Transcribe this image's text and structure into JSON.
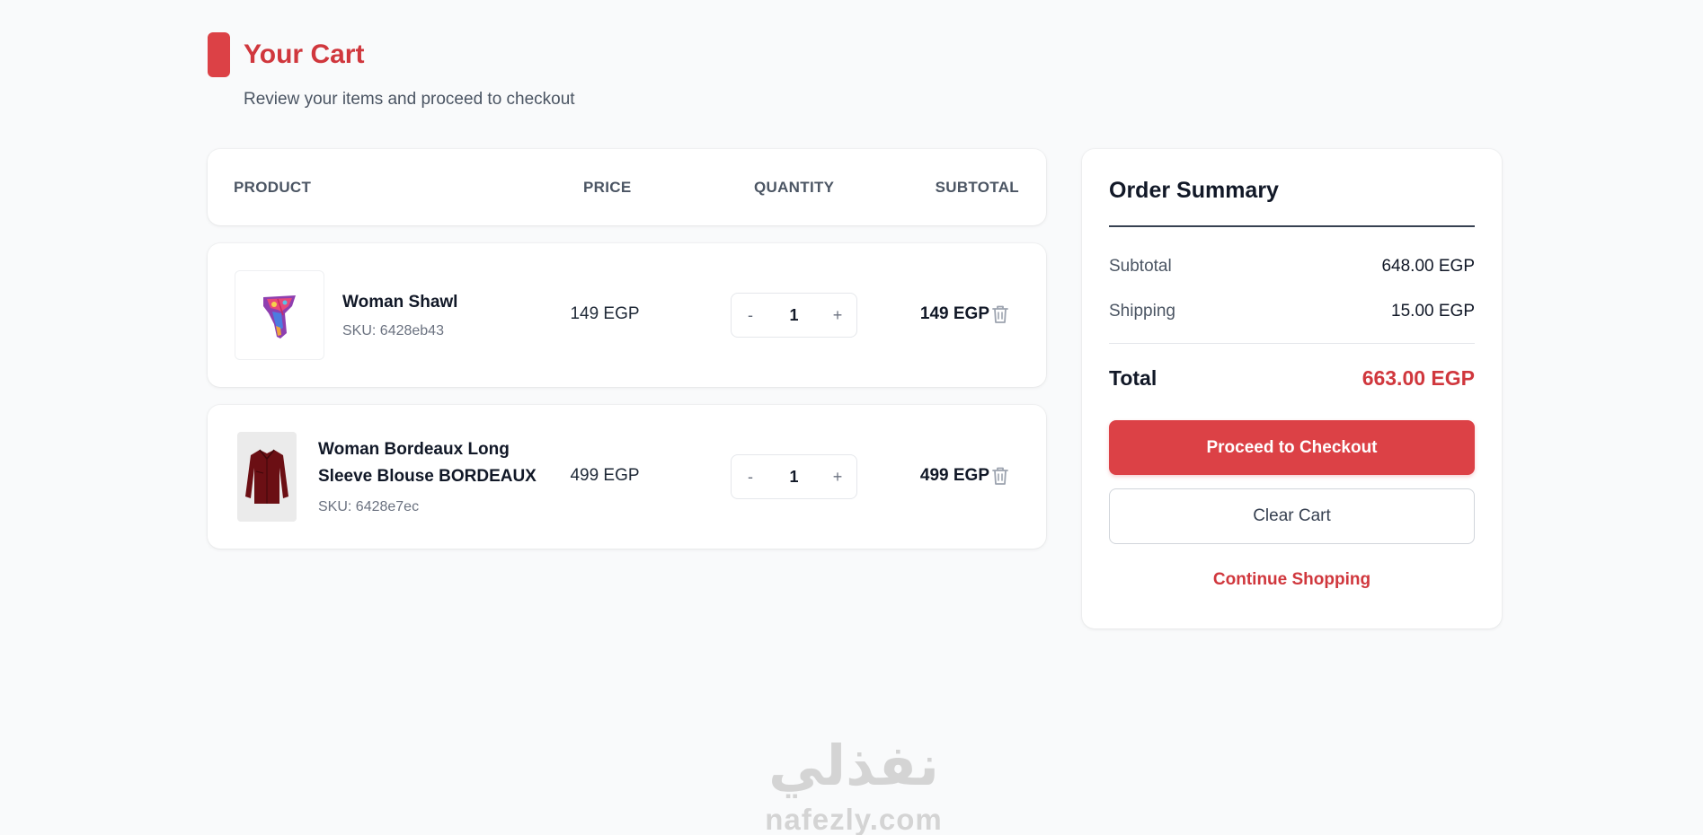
{
  "header": {
    "title": "Your Cart",
    "subtitle": "Review your items and proceed to checkout"
  },
  "table": {
    "columns": [
      "PRODUCT",
      "PRICE",
      "QUANTITY",
      "SUBTOTAL"
    ]
  },
  "cart_items": [
    {
      "name": "Woman Shawl",
      "sku": "SKU: 6428eb43",
      "price": "149 EGP",
      "quantity": "1",
      "subtotal": "149 EGP",
      "decrement_label": "-",
      "increment_label": "+"
    },
    {
      "name": "Woman Bordeaux Long Sleeve Blouse BORDEAUX",
      "sku": "SKU: 6428e7ec",
      "price": "499 EGP",
      "quantity": "1",
      "subtotal": "499 EGP",
      "decrement_label": "-",
      "increment_label": "+"
    }
  ],
  "summary": {
    "title": "Order Summary",
    "subtotal_label": "Subtotal",
    "subtotal_value": "648.00 EGP",
    "shipping_label": "Shipping",
    "shipping_value": "15.00 EGP",
    "total_label": "Total",
    "total_value": "663.00 EGP",
    "checkout_label": "Proceed to Checkout",
    "clear_label": "Clear Cart",
    "continue_label": "Continue Shopping"
  },
  "footer": {
    "logo_arabic": "نفذلي",
    "logo_latin": "nafezly.com"
  },
  "colors": {
    "accent": "#dc4146",
    "accent_text": "#d0373d",
    "background": "#f9fafb"
  },
  "icons": {
    "delete": "trash-icon"
  }
}
